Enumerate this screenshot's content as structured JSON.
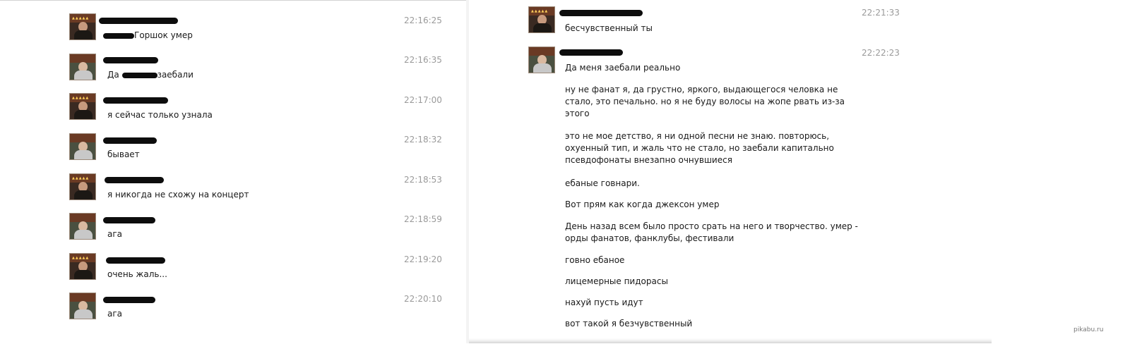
{
  "left_conversation": [
    {
      "time": "22:16:25",
      "text": "Горшок умер"
    },
    {
      "time": "22:16:35",
      "text_before": "Да",
      "text_after": "заебали"
    },
    {
      "time": "22:17:00",
      "text": "я сейчас только узнала"
    },
    {
      "time": "22:18:32",
      "text": "бывает"
    },
    {
      "time": "22:18:53",
      "text": "я никогда не схожу на концерт"
    },
    {
      "time": "22:18:59",
      "text": "ага"
    },
    {
      "time": "22:19:20",
      "text": "очень жаль..."
    },
    {
      "time": "22:20:10",
      "text": "ага"
    }
  ],
  "right_conversation": {
    "msg1": {
      "time": "22:21:33",
      "text": "бесчувственный ты"
    },
    "msg2": {
      "time": "22:22:23",
      "lines": [
        "Да меня заебали реально",
        "ну не фанат я, да грустно, яркого, выдающегося человка не\nстало, это печально. но я не буду волосы на жопе рвать из-за\nэтого",
        "это не мое детство, я ни одной песни не знаю. повторюсь,\nохуенный тип, и жаль что не стало, но заебали капитально\nпсевдофонаты внезапно очнувшиеся",
        "ебаные говнари.",
        "Вот прям как когда джексон умер",
        "День назад всем было просто срать на него и творчество. умер -\nорды фанатов, фанклубы, фестивали",
        "говно ебаное",
        "лицемерные пидорасы",
        "нахуй пусть идут",
        "вот такой я безчувственный"
      ]
    }
  },
  "watermark": "pikabu.ru"
}
